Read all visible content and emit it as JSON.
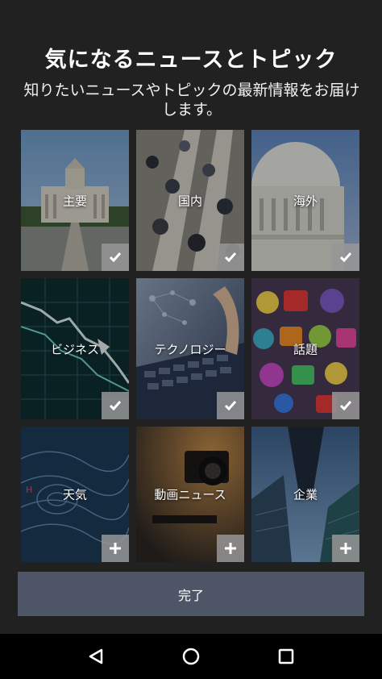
{
  "header": {
    "title": "気になるニュースとトピック",
    "subtitle": "知りたいニュースやトピックの最新情報をお届けします。"
  },
  "tiles": [
    {
      "label": "主要",
      "state": "selected",
      "icon": "check-icon"
    },
    {
      "label": "国内",
      "state": "selected",
      "icon": "check-icon"
    },
    {
      "label": "海外",
      "state": "selected",
      "icon": "check-icon"
    },
    {
      "label": "ビジネス",
      "state": "selected",
      "icon": "check-icon"
    },
    {
      "label": "テクノロジー",
      "state": "selected",
      "icon": "check-icon"
    },
    {
      "label": "話題",
      "state": "selected",
      "icon": "check-icon"
    },
    {
      "label": "天気",
      "state": "unselected",
      "icon": "plus-icon"
    },
    {
      "label": "動画ニュース",
      "state": "unselected",
      "icon": "plus-icon"
    },
    {
      "label": "企業",
      "state": "unselected",
      "icon": "plus-icon"
    }
  ],
  "done_button": {
    "label": "完了"
  },
  "navbar": {
    "back_icon": "back-triangle-icon",
    "home_icon": "home-circle-icon",
    "recents_icon": "recents-square-icon"
  },
  "colors": {
    "background": "#212121",
    "button": "#4e5566",
    "badge": "#969696",
    "navbar": "#000000"
  }
}
